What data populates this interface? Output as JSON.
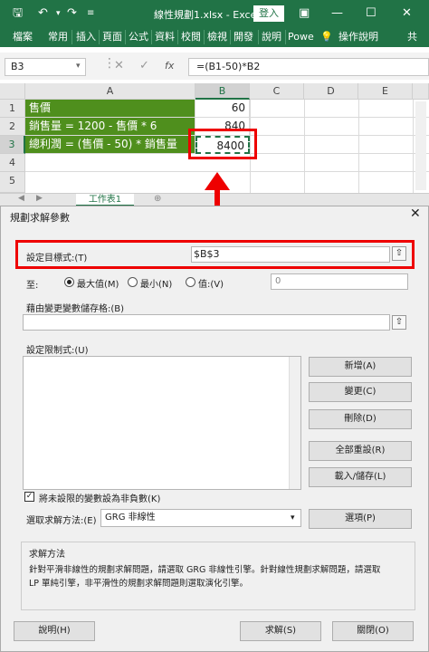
{
  "titlebar": {
    "title": "線性規劃1.xlsx - Excel",
    "login": "登入",
    "icons": [
      "save-icon",
      "undo-icon",
      "redo-icon",
      "customize-icon"
    ]
  },
  "ribbon": {
    "tabs": [
      "檔案",
      "常用",
      "插入",
      "頁面",
      "公式",
      "資料",
      "校閱",
      "檢視",
      "開發",
      "說明",
      "Powe",
      "操作說明",
      "共"
    ]
  },
  "formula_bar": {
    "name_box": "B3",
    "formula": "=(B1-50)*B2"
  },
  "grid": {
    "columns": [
      "A",
      "B",
      "C",
      "D",
      "E"
    ],
    "rows": [
      "1",
      "2",
      "3",
      "4",
      "5"
    ],
    "A1": "售價",
    "B1": "60",
    "A2": "銷售量 = 1200 - 售價 * 6",
    "B2": "840",
    "A3": "總利潤 = (售價 - 50) * 銷售量",
    "B3": "8400",
    "sheet_tab": "工作表1"
  },
  "dialog": {
    "title": "規劃求解參數",
    "objective_label": "設定目標式:(T)",
    "objective_value": "$B$3",
    "to_label": "至:",
    "radio_max": "最大值(M)",
    "radio_min": "最小(N)",
    "radio_value": "值:(V)",
    "value_input": "0",
    "changing_label": "藉由變更變數儲存格:(B)",
    "constraints_label": "設定限制式:(U)",
    "btn_add": "新增(A)",
    "btn_change": "變更(C)",
    "btn_delete": "刪除(D)",
    "btn_reset": "全部重設(R)",
    "btn_load": "載入/儲存(L)",
    "nonneg_label": "將未設限的變數設為非負數(K)",
    "method_label": "選取求解方法:(E)",
    "method_value": "GRG 非線性",
    "btn_options": "選項(P)",
    "desc_title": "求解方法",
    "desc_text1": "針對平滑非線性的規劃求解問題，請選取 GRG 非線性引擎。針對線性規劃求解問題，請選取",
    "desc_text2": "LP 單純引擎，非平滑性的規劃求解問題則選取演化引擎。",
    "btn_help": "說明(H)",
    "btn_solve": "求解(S)",
    "btn_close": "關閉(O)"
  }
}
